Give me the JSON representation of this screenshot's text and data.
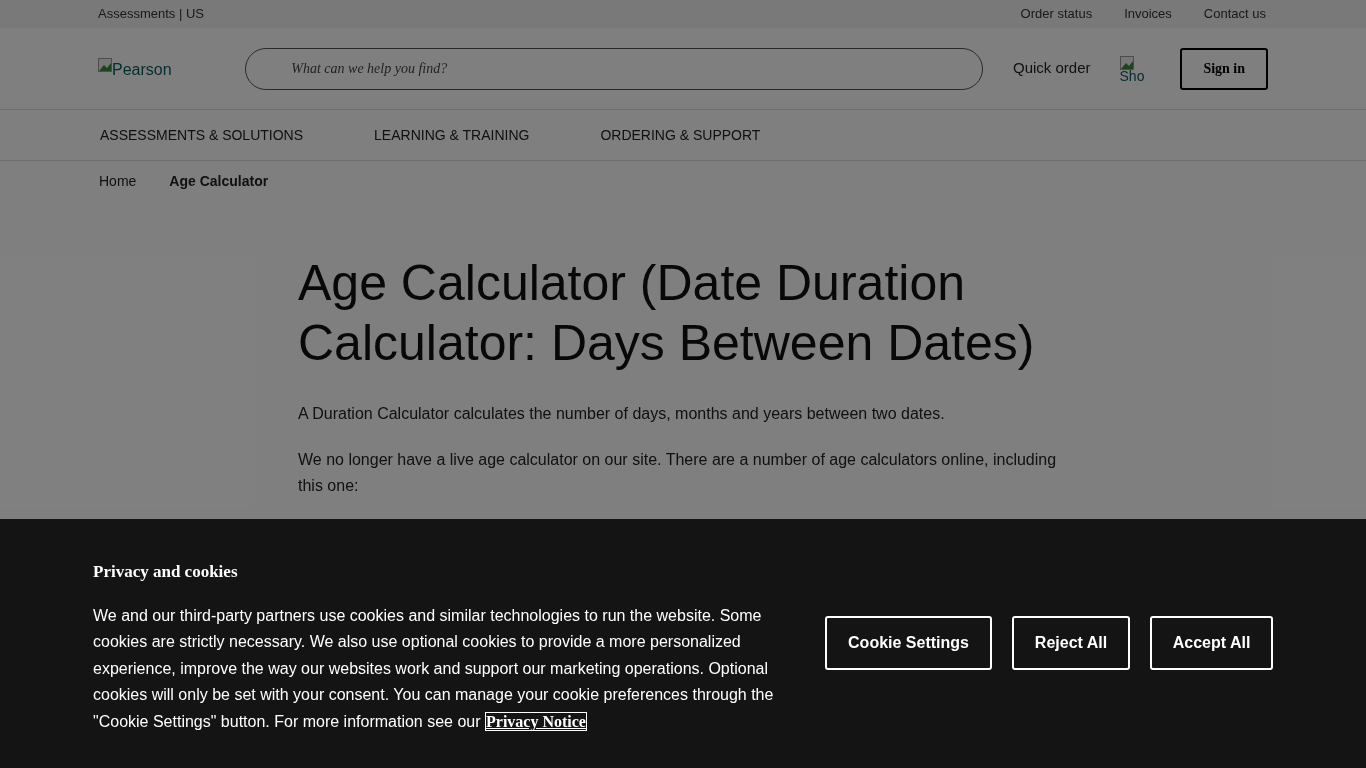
{
  "utility_bar": {
    "site": "Assessments | US",
    "links": [
      "Order status",
      "Invoices",
      "Contact us"
    ]
  },
  "header": {
    "logo_alt": "Pearson",
    "search": {
      "placeholder": "What can we help you find?"
    },
    "quick_order": "Quick order",
    "cart_alt": "Sho",
    "sign_in": "Sign in"
  },
  "nav": [
    "ASSESSMENTS & SOLUTIONS",
    "LEARNING & TRAINING",
    "ORDERING & SUPPORT"
  ],
  "breadcrumbs": [
    {
      "label": "Home",
      "current": false
    },
    {
      "label": "Age Calculator",
      "current": true
    }
  ],
  "article": {
    "title": "Age Calculator (Date Duration Calculator: Days Between Dates)",
    "paragraphs": [
      "A Duration Calculator calculates the number of days, months and years between two dates.",
      "We no longer have a live age calculator on our site. There are a number of age calculators online, including this one:"
    ]
  },
  "cookie_banner": {
    "title": "Privacy and cookies",
    "text": "We and our third-party partners use cookies and similar technologies to run the website. Some cookies are strictly necessary. We also use optional cookies to provide a more personalized experience, improve the way our websites work and support our marketing operations. Optional cookies will only be set with your consent. You can manage your cookie preferences through the \"Cookie Settings\" button. For more information see our",
    "link": "Privacy Notice",
    "buttons": [
      "Cookie Settings",
      "Reject All",
      "Accept All"
    ]
  }
}
